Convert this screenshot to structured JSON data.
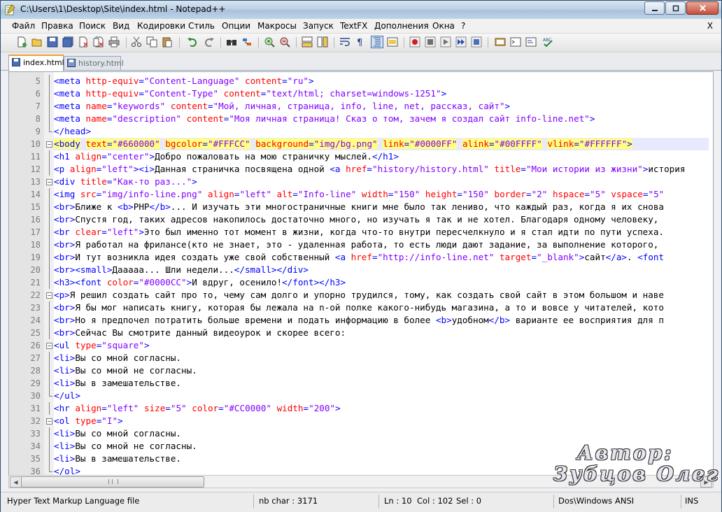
{
  "window": {
    "title": "C:\\Users\\1\\Desktop\\Site\\index.html - Notepad++"
  },
  "menu": {
    "items": [
      "Файл",
      "Правка",
      "Поиск",
      "Вид",
      "Кодировки",
      "Стиль",
      "Опции",
      "Макросы",
      "Запуск",
      "TextFX",
      "Дополнения",
      "Окна",
      "?"
    ],
    "close_label": "X"
  },
  "tabs": [
    {
      "label": "index.html",
      "active": true
    },
    {
      "label": "history.html",
      "active": false
    }
  ],
  "editor": {
    "current_line": 10,
    "lines": [
      {
        "n": "5",
        "fold": "line",
        "tokens": [
          [
            "t",
            "<meta "
          ],
          [
            "a",
            "http-equiv"
          ],
          [
            "t",
            "="
          ],
          [
            "v",
            "\"Content-Language\""
          ],
          [
            "x",
            " "
          ],
          [
            "a",
            "content"
          ],
          [
            "t",
            "="
          ],
          [
            "v",
            "\"ru\""
          ],
          [
            "t",
            ">"
          ]
        ]
      },
      {
        "n": "6",
        "fold": "line",
        "tokens": [
          [
            "t",
            "<meta "
          ],
          [
            "a",
            "http-equiv"
          ],
          [
            "t",
            "="
          ],
          [
            "v",
            "\"Content-Type\""
          ],
          [
            "x",
            " "
          ],
          [
            "a",
            "content"
          ],
          [
            "t",
            "="
          ],
          [
            "v",
            "\"text/html; charset=windows-1251\""
          ],
          [
            "t",
            ">"
          ]
        ]
      },
      {
        "n": "7",
        "fold": "line",
        "tokens": [
          [
            "t",
            "<meta "
          ],
          [
            "a",
            "name"
          ],
          [
            "t",
            "="
          ],
          [
            "v",
            "\"keywords\""
          ],
          [
            "x",
            " "
          ],
          [
            "a",
            "content"
          ],
          [
            "t",
            "="
          ],
          [
            "v",
            "\"Мой, личная, страница, info, line, net, рассказ, сайт\""
          ],
          [
            "t",
            ">"
          ]
        ]
      },
      {
        "n": "8",
        "fold": "line",
        "tokens": [
          [
            "t",
            "<meta "
          ],
          [
            "a",
            "name"
          ],
          [
            "t",
            "="
          ],
          [
            "v",
            "\"description\""
          ],
          [
            "x",
            " "
          ],
          [
            "a",
            "content"
          ],
          [
            "t",
            "="
          ],
          [
            "v",
            "\"Моя личная страница! Сказ о том, зачем я создал сайт info-line.net\""
          ],
          [
            "t",
            ">"
          ]
        ]
      },
      {
        "n": "9",
        "fold": "end",
        "tokens": [
          [
            "t",
            "</head>"
          ]
        ]
      },
      {
        "n": "10",
        "fold": "box",
        "tokens": [
          [
            "th",
            "<body"
          ],
          [
            "x",
            " "
          ],
          [
            "ah",
            "text"
          ],
          [
            "th",
            "="
          ],
          [
            "vh",
            "\"#660000\""
          ],
          [
            "x",
            " "
          ],
          [
            "ah",
            "bgcolor"
          ],
          [
            "th",
            "="
          ],
          [
            "vh",
            "\"#FFFCC\""
          ],
          [
            "x",
            " "
          ],
          [
            "ah",
            "background"
          ],
          [
            "th",
            "="
          ],
          [
            "vh",
            "\"img/bg.png\""
          ],
          [
            "x",
            " "
          ],
          [
            "ah",
            "link"
          ],
          [
            "th",
            "="
          ],
          [
            "vh",
            "\"#0000FF\""
          ],
          [
            "x",
            " "
          ],
          [
            "ah",
            "alink"
          ],
          [
            "th",
            "="
          ],
          [
            "vh",
            "\"#00FFFF\""
          ],
          [
            "x",
            " "
          ],
          [
            "ah",
            "vlink"
          ],
          [
            "th",
            "="
          ],
          [
            "vh",
            "\"#FFFFFF\""
          ],
          [
            "th",
            ">"
          ]
        ]
      },
      {
        "n": "11",
        "fold": "line",
        "tokens": [
          [
            "t",
            "<h1 "
          ],
          [
            "a",
            "align"
          ],
          [
            "t",
            "="
          ],
          [
            "v",
            "\"center\""
          ],
          [
            "t",
            ">"
          ],
          [
            "x",
            "Добро пожаловать на мою страничку мыслей."
          ],
          [
            "t",
            "</h1>"
          ]
        ]
      },
      {
        "n": "12",
        "fold": "line",
        "tokens": [
          [
            "t",
            "<p "
          ],
          [
            "a",
            "align"
          ],
          [
            "t",
            "="
          ],
          [
            "v",
            "\"left\""
          ],
          [
            "t",
            "><i>"
          ],
          [
            "x",
            "Данная страничка посвящена одной "
          ],
          [
            "t",
            "<a "
          ],
          [
            "a",
            "href"
          ],
          [
            "t",
            "="
          ],
          [
            "v",
            "\"history/history.html\""
          ],
          [
            "x",
            " "
          ],
          [
            "a",
            "title"
          ],
          [
            "t",
            "="
          ],
          [
            "v",
            "\"Мои истории из жизни\""
          ],
          [
            "t",
            ">"
          ],
          [
            "x",
            "история"
          ]
        ]
      },
      {
        "n": "13",
        "fold": "box",
        "tokens": [
          [
            "t",
            "<div "
          ],
          [
            "a",
            "title"
          ],
          [
            "t",
            "="
          ],
          [
            "v",
            "\"Как-то раз...\""
          ],
          [
            "t",
            ">"
          ]
        ]
      },
      {
        "n": "14",
        "fold": "line",
        "tokens": [
          [
            "t",
            "<img "
          ],
          [
            "a",
            "src"
          ],
          [
            "t",
            "="
          ],
          [
            "v",
            "\"img/info-line.png\""
          ],
          [
            "x",
            " "
          ],
          [
            "a",
            "align"
          ],
          [
            "t",
            "="
          ],
          [
            "v",
            "\"left\""
          ],
          [
            "x",
            " "
          ],
          [
            "a",
            "alt"
          ],
          [
            "t",
            "="
          ],
          [
            "v",
            "\"Info-line\""
          ],
          [
            "x",
            " "
          ],
          [
            "a",
            "width"
          ],
          [
            "t",
            "="
          ],
          [
            "v",
            "\"150\""
          ],
          [
            "x",
            " "
          ],
          [
            "a",
            "height"
          ],
          [
            "t",
            "="
          ],
          [
            "v",
            "\"150\""
          ],
          [
            "x",
            " "
          ],
          [
            "a",
            "border"
          ],
          [
            "t",
            "="
          ],
          [
            "v",
            "\"2\""
          ],
          [
            "x",
            " "
          ],
          [
            "a",
            "hspace"
          ],
          [
            "t",
            "="
          ],
          [
            "v",
            "\"5\""
          ],
          [
            "x",
            " "
          ],
          [
            "a",
            "vspace"
          ],
          [
            "t",
            "="
          ],
          [
            "v",
            "\"5\""
          ]
        ]
      },
      {
        "n": "15",
        "fold": "line",
        "tokens": [
          [
            "t",
            "<br>"
          ],
          [
            "x",
            "Ближе к "
          ],
          [
            "t",
            "<b>"
          ],
          [
            "x",
            "PHP"
          ],
          [
            "t",
            "</b>"
          ],
          [
            "x",
            "... И изучать эти многостраничные книги мне было так лениво, что каждый раз, когда я их снова"
          ]
        ]
      },
      {
        "n": "16",
        "fold": "line",
        "tokens": [
          [
            "t",
            "<br>"
          ],
          [
            "x",
            "Спустя год, таких адресов накопилось достаточно много, но изучать я так и не хотел. Благодаря одному человеку,"
          ]
        ]
      },
      {
        "n": "17",
        "fold": "line",
        "tokens": [
          [
            "t",
            "<br "
          ],
          [
            "a",
            "clear"
          ],
          [
            "t",
            "="
          ],
          [
            "v",
            "\"left\""
          ],
          [
            "t",
            ">"
          ],
          [
            "x",
            "Это был именно тот момент в жизни, когда что-то внутри пересчелкнуло и я стал идти по пути успеха."
          ]
        ]
      },
      {
        "n": "18",
        "fold": "line",
        "tokens": [
          [
            "t",
            "<br>"
          ],
          [
            "x",
            "Я работал на фрилансе(кто не знает, это - удаленная работа, то есть люди дают задание, за выполнение которого,"
          ]
        ]
      },
      {
        "n": "19",
        "fold": "line",
        "tokens": [
          [
            "t",
            "<br>"
          ],
          [
            "x",
            "И тут возникла идея создать уже свой собственный "
          ],
          [
            "t",
            "<a "
          ],
          [
            "a",
            "href"
          ],
          [
            "t",
            "="
          ],
          [
            "v",
            "\"http://info-line.net\""
          ],
          [
            "x",
            " "
          ],
          [
            "a",
            "target"
          ],
          [
            "t",
            "="
          ],
          [
            "v",
            "\"_blank\""
          ],
          [
            "t",
            ">"
          ],
          [
            "x",
            "сайт"
          ],
          [
            "t",
            "</a>"
          ],
          [
            "x",
            ". "
          ],
          [
            "t",
            "<font"
          ]
        ]
      },
      {
        "n": "20",
        "fold": "line",
        "tokens": [
          [
            "t",
            "<br><small>"
          ],
          [
            "x",
            "Дааааа... Шли недели..."
          ],
          [
            "t",
            "</small></div>"
          ]
        ]
      },
      {
        "n": "21",
        "fold": "line",
        "tokens": [
          [
            "t",
            "<h3><font "
          ],
          [
            "a",
            "color"
          ],
          [
            "t",
            "="
          ],
          [
            "v",
            "\"#0000CC\""
          ],
          [
            "t",
            ">"
          ],
          [
            "x",
            "И вдруг, осенило!"
          ],
          [
            "t",
            "</font></h3>"
          ]
        ]
      },
      {
        "n": "22",
        "fold": "box",
        "tokens": [
          [
            "t",
            "<p>"
          ],
          [
            "x",
            "Я решил создать сайт про то, чему сам долго и упорно трудился, тому, как создать свой сайт в этом большом и наве"
          ]
        ]
      },
      {
        "n": "23",
        "fold": "line",
        "tokens": [
          [
            "t",
            "<br>"
          ],
          [
            "x",
            "Я бы мог написать книгу, которая бы лежала на n-ой полке какого-нибудь магазина, а то и вовсе у читателей, кото"
          ]
        ]
      },
      {
        "n": "24",
        "fold": "line",
        "tokens": [
          [
            "t",
            "<br>"
          ],
          [
            "x",
            "Но я предпочел потратить больше времени и подать информацию в более "
          ],
          [
            "t",
            "<b>"
          ],
          [
            "x",
            "удобном"
          ],
          [
            "t",
            "</b>"
          ],
          [
            "x",
            " варианте ее восприятия для п"
          ]
        ]
      },
      {
        "n": "25",
        "fold": "line",
        "tokens": [
          [
            "t",
            "<br>"
          ],
          [
            "x",
            "Сейчас Вы смотрите данный видеоурок и скорее всего:"
          ]
        ]
      },
      {
        "n": "26",
        "fold": "box",
        "tokens": [
          [
            "t",
            "<ul "
          ],
          [
            "a",
            "type"
          ],
          [
            "t",
            "="
          ],
          [
            "v",
            "\"square\""
          ],
          [
            "t",
            ">"
          ]
        ]
      },
      {
        "n": "27",
        "fold": "line",
        "tokens": [
          [
            "t",
            "<li>"
          ],
          [
            "x",
            "Вы со мной согласны."
          ]
        ]
      },
      {
        "n": "28",
        "fold": "line",
        "tokens": [
          [
            "t",
            "<li>"
          ],
          [
            "x",
            "Вы со мной не согласны."
          ]
        ]
      },
      {
        "n": "29",
        "fold": "line",
        "tokens": [
          [
            "t",
            "<li>"
          ],
          [
            "x",
            "Вы в замешательстве."
          ]
        ]
      },
      {
        "n": "30",
        "fold": "end",
        "tokens": [
          [
            "t",
            "</ul>"
          ]
        ]
      },
      {
        "n": "31",
        "fold": "line",
        "tokens": [
          [
            "t",
            "<hr "
          ],
          [
            "a",
            "align"
          ],
          [
            "t",
            "="
          ],
          [
            "v",
            "\"left\""
          ],
          [
            "x",
            " "
          ],
          [
            "a",
            "size"
          ],
          [
            "t",
            "="
          ],
          [
            "v",
            "\"5\""
          ],
          [
            "x",
            " "
          ],
          [
            "a",
            "color"
          ],
          [
            "t",
            "="
          ],
          [
            "v",
            "\"#CC0000\""
          ],
          [
            "x",
            " "
          ],
          [
            "a",
            "width"
          ],
          [
            "t",
            "="
          ],
          [
            "v",
            "\"200\""
          ],
          [
            "t",
            ">"
          ]
        ]
      },
      {
        "n": "32",
        "fold": "box",
        "tokens": [
          [
            "t",
            "<ol "
          ],
          [
            "a",
            "type"
          ],
          [
            "t",
            "="
          ],
          [
            "v",
            "\"I\""
          ],
          [
            "t",
            ">"
          ]
        ]
      },
      {
        "n": "33",
        "fold": "line",
        "tokens": [
          [
            "t",
            "<li>"
          ],
          [
            "x",
            "Вы со мной согласны."
          ]
        ]
      },
      {
        "n": "34",
        "fold": "line",
        "tokens": [
          [
            "t",
            "<li>"
          ],
          [
            "x",
            "Вы со мной не согласны."
          ]
        ]
      },
      {
        "n": "35",
        "fold": "line",
        "tokens": [
          [
            "t",
            "<li>"
          ],
          [
            "x",
            "Вы в замешательстве."
          ]
        ]
      },
      {
        "n": "36",
        "fold": "end",
        "tokens": [
          [
            "t",
            "</ol>"
          ]
        ]
      }
    ]
  },
  "watermark": {
    "line1": "Автор:",
    "line2": "Зубцов Олег"
  },
  "status": {
    "file_type": "Hyper Text Markup Language file",
    "nb_char": "nb char : 3171",
    "ln": "Ln : 10",
    "col": "Col : 102",
    "sel": "Sel : 0",
    "eol": "Dos\\Windows",
    "encoding": "ANSI",
    "ins": "INS"
  },
  "colors": {
    "tag": "#0000ff",
    "attribute": "#ff0000",
    "value": "#8000ff",
    "highlight": "#ffff80"
  }
}
